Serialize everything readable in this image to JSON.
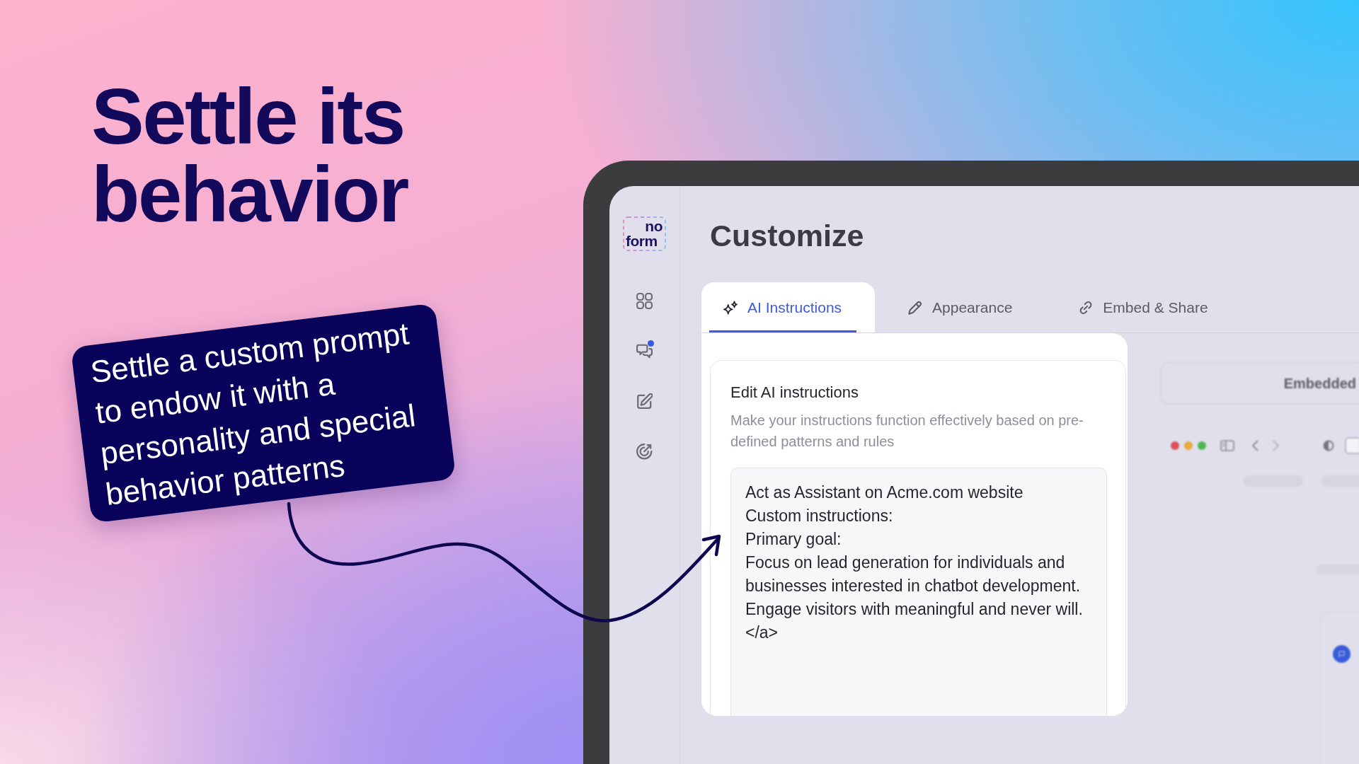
{
  "headline": "Settle its behavior",
  "callout": {
    "text": "Settle a custom prompt to endow it with a personality and special behavior patterns"
  },
  "app": {
    "logo": [
      "no",
      "form"
    ],
    "sidebar": {
      "items": [
        {
          "notification": false
        },
        {
          "notification": true
        },
        {
          "notification": false
        },
        {
          "notification": false
        }
      ]
    },
    "page_title": "Customize",
    "tabs": [
      {
        "label": "AI Instructions",
        "selected": true
      },
      {
        "label": "Appearance",
        "selected": false
      },
      {
        "label": "Embed & Share",
        "selected": false
      }
    ],
    "instructions_card": {
      "title": "Edit AI instructions",
      "description": "Make your instructions function effectively based on pre-defined patterns and rules",
      "value": "Act as Assistant on Acme.com website\nCustom instructions:\nPrimary goal:\nFocus on lead generation for individuals and businesses interested in chatbot development.\nEngage visitors with meaningful and never will.\n</a>"
    },
    "preview": {
      "mode": "Embedded"
    }
  }
}
